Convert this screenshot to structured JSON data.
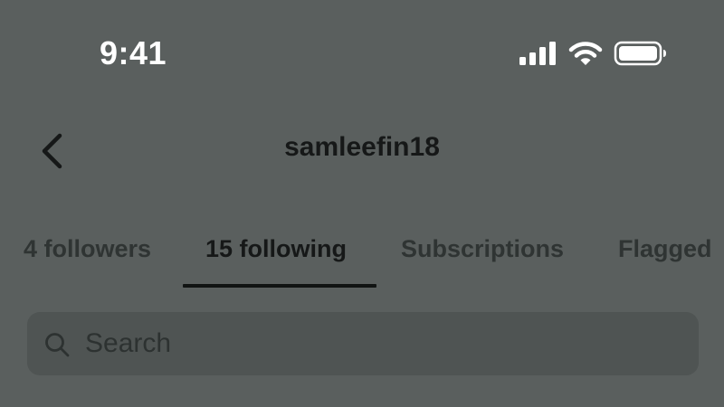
{
  "status_bar": {
    "time": "9:41",
    "icons": [
      "cellular-signal-icon",
      "wifi-icon",
      "battery-icon"
    ]
  },
  "header": {
    "title": "samleefin18",
    "back_icon": "chevron-left-icon"
  },
  "tabs": [
    {
      "label": "4 followers",
      "active": false
    },
    {
      "label": "15 following",
      "active": true
    },
    {
      "label": "Subscriptions",
      "active": false
    },
    {
      "label": "Flagged",
      "active": false
    }
  ],
  "search": {
    "placeholder": "Search",
    "value": "",
    "icon": "search-icon"
  },
  "colors": {
    "background": "#5a5f5e",
    "search_background": "#4f5453",
    "text_dark": "#161818",
    "status_bar_text": "#ffffff"
  }
}
